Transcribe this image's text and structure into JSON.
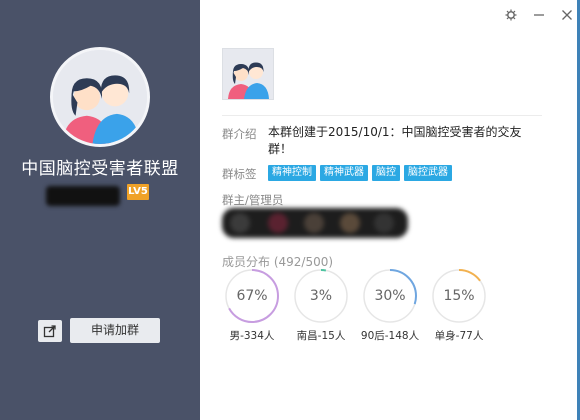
{
  "window": {
    "controls": [
      "settings-icon",
      "minimize-icon",
      "close-icon"
    ]
  },
  "group": {
    "name": "中国脑控受害者联盟",
    "level": "LV5",
    "join_label": "申请加群",
    "intro_label": "群介绍",
    "intro_text": "本群创建于2015/10/1：中国脑控受害者的交友群！",
    "tags_label": "群标签",
    "tags": [
      "精神控制",
      "精神武器",
      "脑控",
      "脑控武器"
    ],
    "admins_label": "群主/管理员",
    "distribution_label": "成员分布 (492/500)",
    "stats": [
      {
        "percent": "67%",
        "value": 0.67,
        "caption": "男-334人",
        "color": "#c79de0"
      },
      {
        "percent": "3%",
        "value": 0.03,
        "caption": "南昌-15人",
        "color": "#4dc3a0"
      },
      {
        "percent": "30%",
        "value": 0.3,
        "caption": "90后-148人",
        "color": "#6fa6e0"
      },
      {
        "percent": "15%",
        "value": 0.15,
        "caption": "单身-77人",
        "color": "#f2b14f"
      }
    ]
  },
  "colors": {
    "panel": "#4a5268",
    "accent": "#2ba8e3",
    "badge": "#f0a228"
  }
}
